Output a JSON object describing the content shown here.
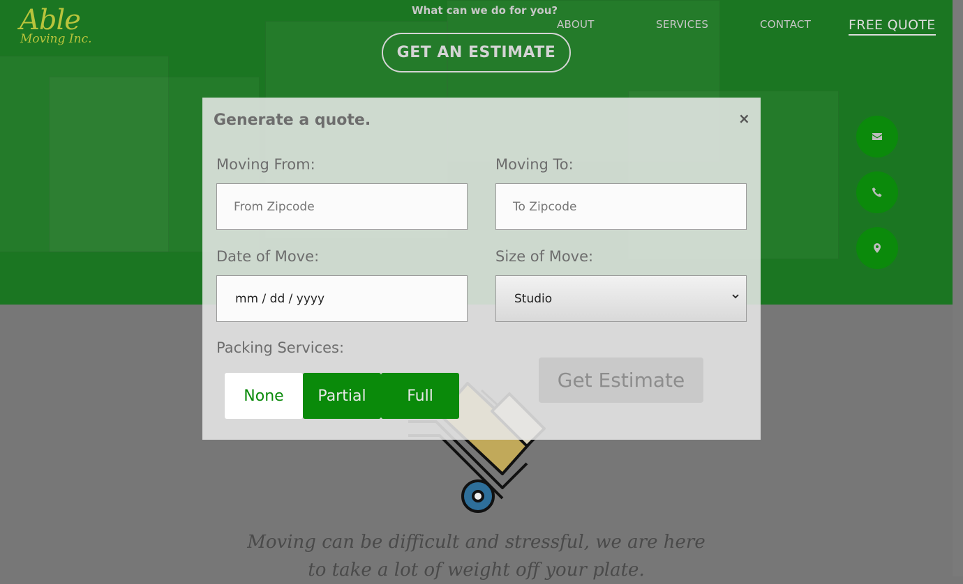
{
  "brand": {
    "logo_main": "Able",
    "logo_sub": "Moving Inc."
  },
  "header": {
    "tagline": "What can we do for you?",
    "nav": [
      {
        "label": "ABOUT"
      },
      {
        "label": "SERVICES"
      },
      {
        "label": "CONTACT"
      },
      {
        "label": "FREE QUOTE"
      }
    ],
    "estimate_button": "GET AN ESTIMATE"
  },
  "side_icons": [
    "envelope-icon",
    "phone-icon",
    "map-marker-icon"
  ],
  "modal": {
    "title": "Generate a quote.",
    "close": "×",
    "moving_from": {
      "label": "Moving From:",
      "placeholder": "From Zipcode"
    },
    "moving_to": {
      "label": "Moving To:",
      "placeholder": "To Zipcode"
    },
    "date": {
      "label": "Date of Move:",
      "placeholder": "mm / dd / yyyy"
    },
    "size": {
      "label": "Size of Move:",
      "selected": "Studio"
    },
    "packing": {
      "label": "Packing Services:",
      "options": [
        "None",
        "Partial",
        "Full"
      ]
    },
    "submit": "Get Estimate"
  },
  "body_text": "Moving can be difficult and stressful, we are here to take a lot of weight off your plate.",
  "colors": {
    "brand_green": "#0a8a0a",
    "hero_green": "#22912a",
    "logo_yellow": "#b9c43c"
  }
}
